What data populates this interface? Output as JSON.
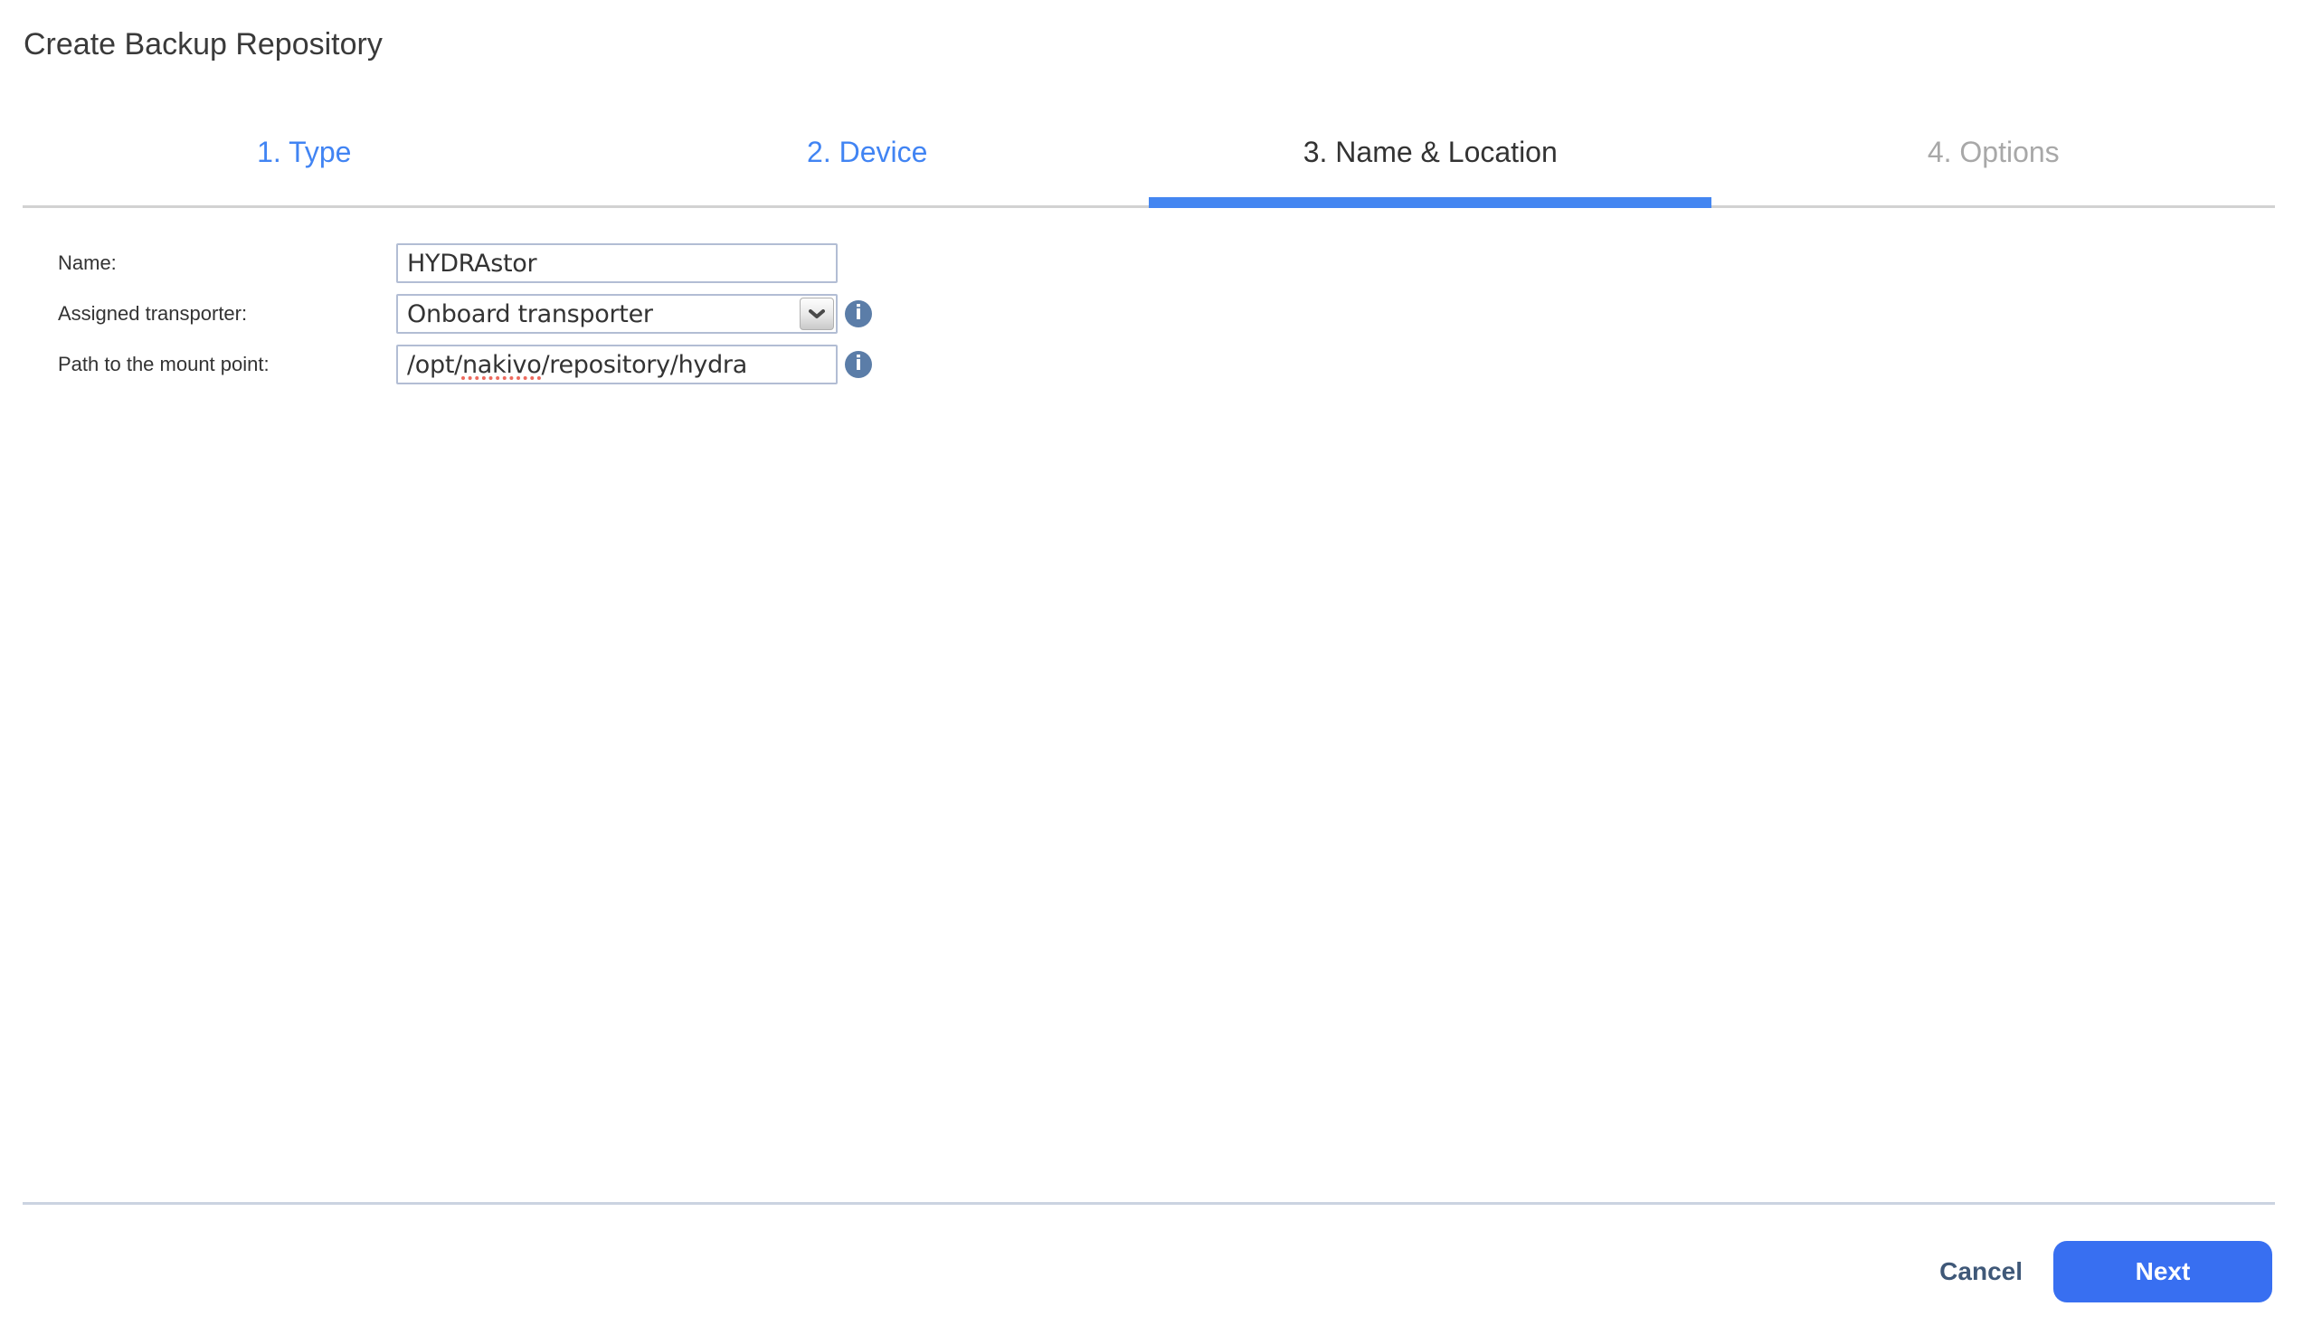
{
  "page_title": "Create Backup Repository",
  "wizard_steps": [
    {
      "label": "1. Type",
      "state": "link"
    },
    {
      "label": "2. Device",
      "state": "link"
    },
    {
      "label": "3. Name & Location",
      "state": "active"
    },
    {
      "label": "4. Options",
      "state": "disabled"
    }
  ],
  "form": {
    "name": {
      "label": "Name:",
      "value": "HYDRAstor"
    },
    "transporter": {
      "label": "Assigned transporter:",
      "value": "Onboard transporter",
      "info_icon": "info-icon"
    },
    "path": {
      "label": "Path to the mount point:",
      "value": "/opt/nakivo/repository/hydra",
      "prefix": "/opt/",
      "misspelled": "nakivo",
      "suffix": "/repository/hydra",
      "info_icon": "info-icon"
    }
  },
  "footer": {
    "cancel": "Cancel",
    "next": "Next"
  },
  "colors": {
    "step_link_blue": "#4184F3",
    "active_step_text": "#333333",
    "disabled_step_text": "#A8A8A8",
    "tab_indicator_blue": "#4486F1",
    "tab_track_gray": "#D2D2D2",
    "input_border": "#B2BDD4",
    "info_icon_blue": "#5B7DA8",
    "spellcheck_red": "#ED6A5E",
    "footer_divider": "#CBD3E1",
    "cancel_text": "#3F5878",
    "next_button_blue": "#386FF1"
  }
}
